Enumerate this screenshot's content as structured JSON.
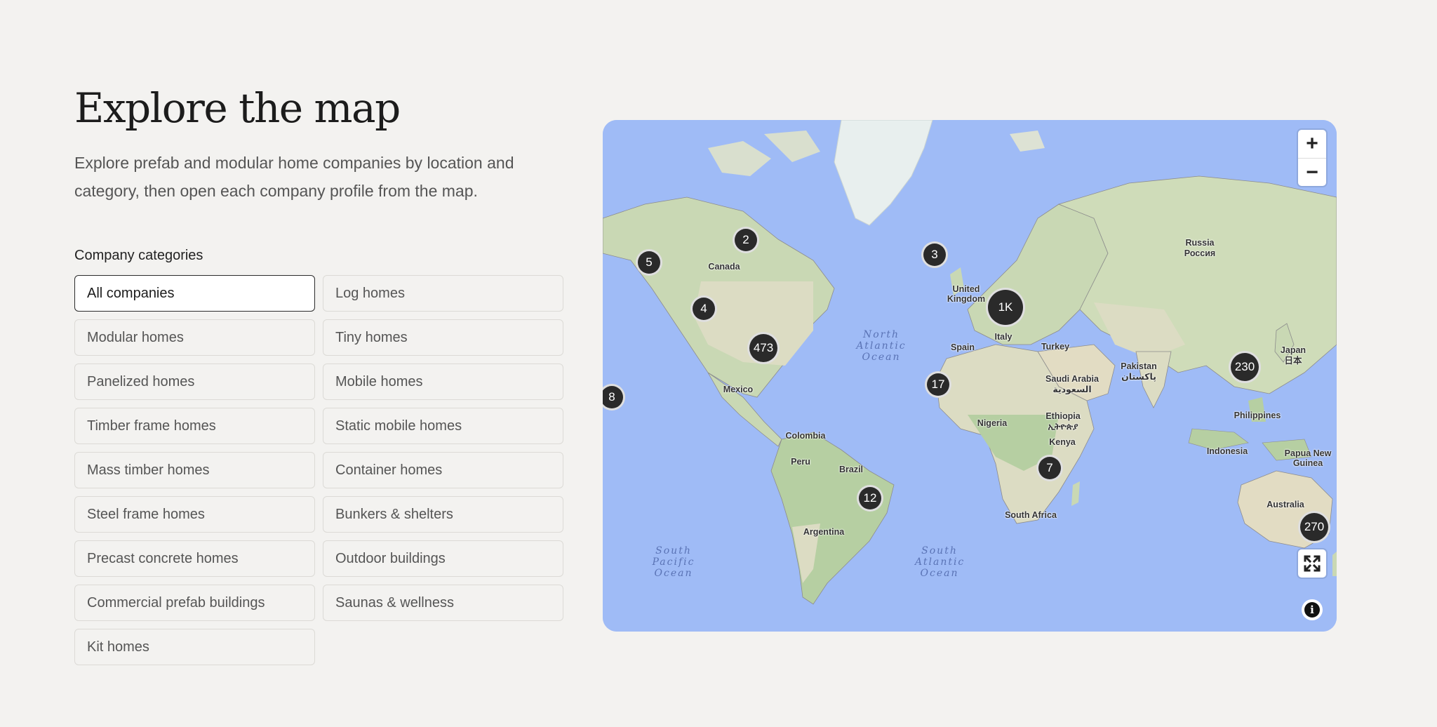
{
  "header": {
    "title": "Explore the map",
    "intro": "Explore prefab and modular home companies by location and category, then open each company profile from the map."
  },
  "categories": {
    "heading": "Company categories",
    "items": [
      {
        "label": "All companies",
        "active": true
      },
      {
        "label": "Log homes"
      },
      {
        "label": "Modular homes"
      },
      {
        "label": "Tiny homes"
      },
      {
        "label": "Panelized homes"
      },
      {
        "label": "Mobile homes"
      },
      {
        "label": "Timber frame homes"
      },
      {
        "label": "Static mobile homes"
      },
      {
        "label": "Mass timber homes"
      },
      {
        "label": "Container homes"
      },
      {
        "label": "Steel frame homes"
      },
      {
        "label": "Bunkers & shelters"
      },
      {
        "label": "Precast concrete homes"
      },
      {
        "label": "Outdoor buildings"
      },
      {
        "label": "Commercial prefab buildings"
      },
      {
        "label": "Saunas & wellness"
      },
      {
        "label": "Kit homes"
      }
    ]
  },
  "map": {
    "controls": {
      "zoom_in": "+",
      "zoom_out": "−",
      "fullscreen_icon": "expand-icon",
      "info_icon": "info-icon",
      "info_text": "i"
    },
    "clusters": [
      "2",
      "5",
      "4",
      "473",
      "8",
      "3",
      "1K",
      "17",
      "7",
      "12",
      "230",
      "270"
    ],
    "labels": [
      "Canada",
      "Mexico",
      "Colombia",
      "Peru",
      "Brazil",
      "Argentina",
      "United Kingdom",
      "Spain",
      "Italy",
      "Turkey",
      "Saudi Arabia",
      "السعودية",
      "Nigeria",
      "Ethiopia",
      "ኢትዮጵያ",
      "Kenya",
      "South Africa",
      "Russia",
      "Россия",
      "Pakistan",
      "پاکستان",
      "Japan",
      "日本",
      "Philippines",
      "Indonesia",
      "Papua New Guinea",
      "Australia"
    ],
    "oceans": [
      "North Atlantic Ocean",
      "South Pacific Ocean",
      "South Atlantic Ocean"
    ],
    "colors": {
      "water": "#9fbbf6",
      "land": "#dcdcc3",
      "forest": "#b6cfa2",
      "ice": "#e8efee",
      "cluster": "#2a2a2a"
    }
  }
}
